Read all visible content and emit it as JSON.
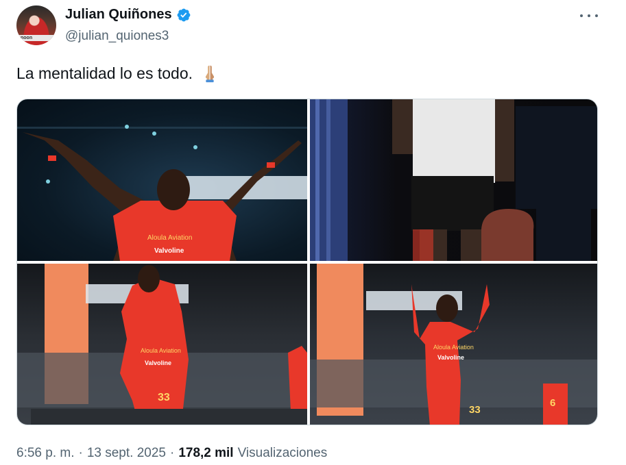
{
  "author": {
    "display_name": "Julian Quiñones",
    "handle": "@julian_quiones3",
    "avatar_text": "noon",
    "verified_color": "#1d9bf0"
  },
  "tweet": {
    "text": "La mentalidad lo es todo.",
    "emoji": "folded-hands",
    "photos": [
      {
        "label": "photo-1",
        "jersey_text": [
          "Aloula Aviation",
          "Valvoline"
        ]
      },
      {
        "label": "photo-2",
        "jersey_text": []
      },
      {
        "label": "photo-3",
        "jersey_text": [
          "Aloula Aviation",
          "Valvoline"
        ],
        "number": "33"
      },
      {
        "label": "photo-4",
        "jersey_text": [
          "Aloula Aviation",
          "Valvoline"
        ],
        "number": "33",
        "background_number": "6"
      }
    ]
  },
  "meta": {
    "time": "6:56 p. m.",
    "separator1": "·",
    "date": "13 sept. 2025",
    "separator2": "·",
    "views_count": "178,2 mil",
    "views_label": "Visualizaciones"
  },
  "colors": {
    "jersey": "#e8382a",
    "text_secondary": "#536471",
    "border": "#cfd9de"
  }
}
